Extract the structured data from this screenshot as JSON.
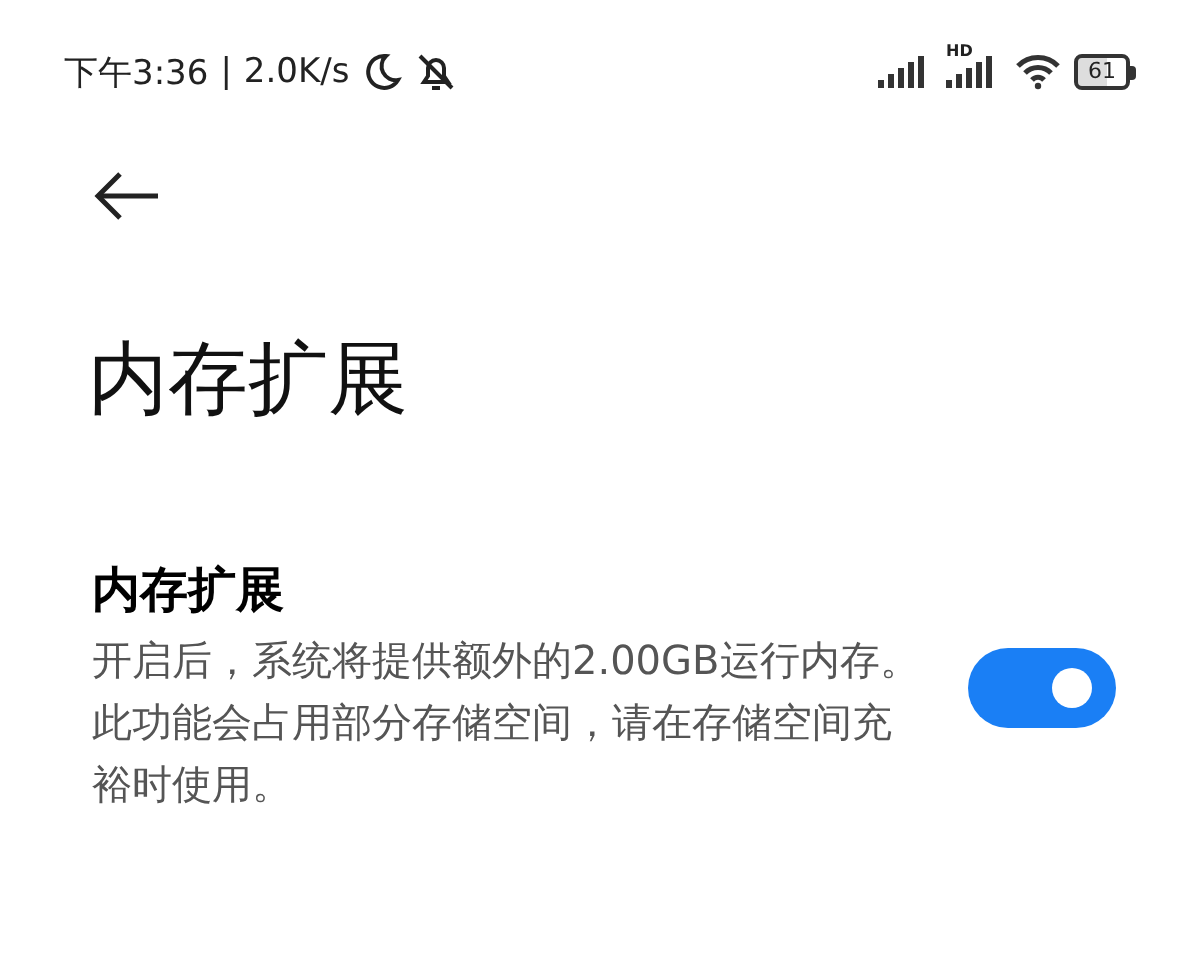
{
  "status_bar": {
    "time": "下午3:36",
    "separator": "|",
    "speed": "2.0K/s",
    "battery": "61",
    "hd": "HD"
  },
  "page": {
    "title": "内存扩展"
  },
  "setting": {
    "title": "内存扩展",
    "description": "开启后，系统将提供额外的2.00GB运行内存。此功能会占用部分存储空间，请在存储空间充裕时使用。",
    "on": true
  }
}
